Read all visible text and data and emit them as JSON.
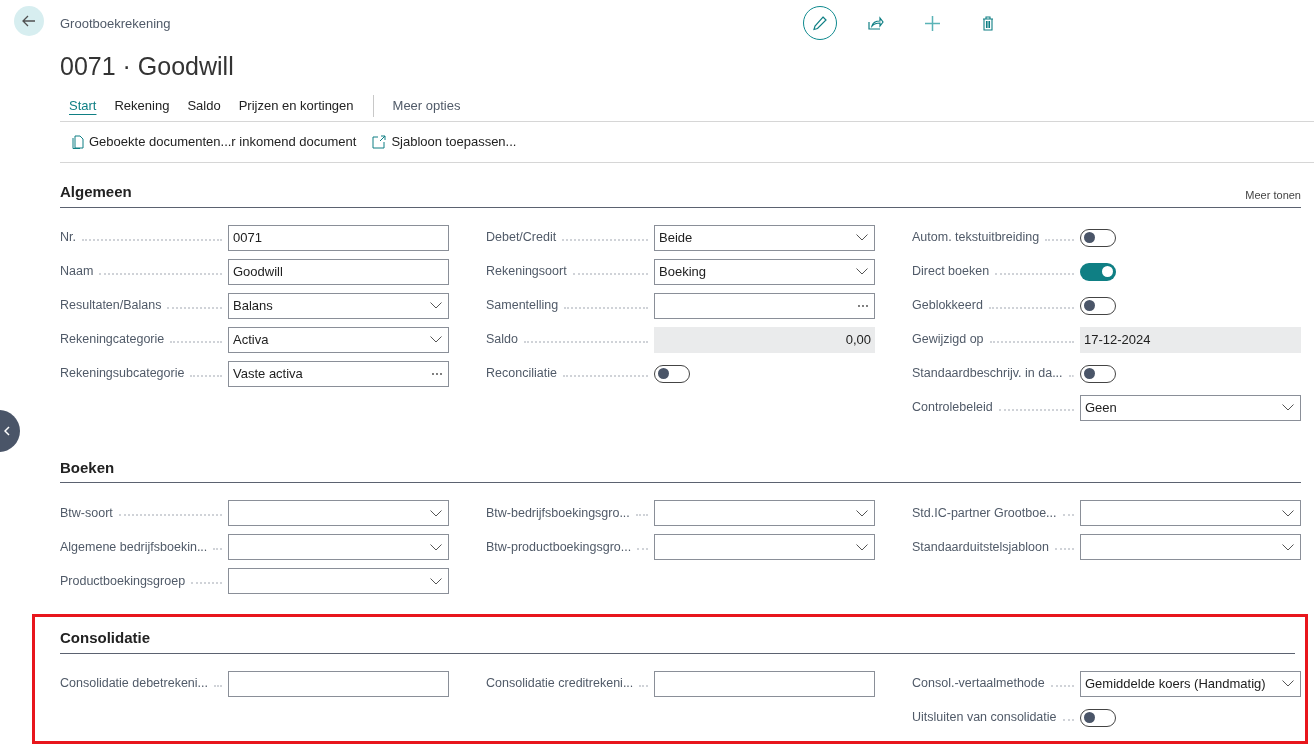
{
  "header": {
    "breadcrumb": "Grootboekrekening",
    "title": "0071 · Goodwill"
  },
  "tabs": [
    {
      "label": "Start",
      "selected": true
    },
    {
      "label": "Rekening",
      "selected": false
    },
    {
      "label": "Saldo",
      "selected": false
    },
    {
      "label": "Prijzen en kortingen",
      "selected": false
    }
  ],
  "more_options": "Meer opties",
  "actions": [
    {
      "label": "Geboekte documenten...r inkomend document",
      "kind": "document"
    },
    {
      "label": "Sjabloon toepassen...",
      "kind": "template"
    }
  ],
  "sections": [
    {
      "title": "Algemeen",
      "show_more": "Meer tonen",
      "highlighted": false,
      "columns": [
        [
          {
            "label": "Nr.",
            "kind": "text",
            "value": "0071"
          },
          {
            "label": "Naam",
            "kind": "text",
            "value": "Goodwill"
          },
          {
            "label": "Resultaten/Balans",
            "kind": "select",
            "value": "Balans"
          },
          {
            "label": "Rekeningcategorie",
            "kind": "select",
            "value": "Activa"
          },
          {
            "label": "Rekeningsubcategorie",
            "kind": "lookup",
            "value": "Vaste activa"
          }
        ],
        [
          {
            "label": "Debet/Credit",
            "kind": "select",
            "value": "Beide"
          },
          {
            "label": "Rekeningsoort",
            "kind": "select",
            "value": "Boeking"
          },
          {
            "label": "Samentelling",
            "kind": "lookup"
          },
          {
            "label": "Saldo",
            "kind": "amount",
            "value": "0,00"
          },
          {
            "label": "Reconciliatie",
            "kind": "toggle",
            "on": false
          }
        ],
        [
          {
            "label": "Autom. tekstuitbreiding",
            "kind": "toggle",
            "on": false
          },
          {
            "label": "Direct boeken",
            "kind": "toggle",
            "on": true
          },
          {
            "label": "Geblokkeerd",
            "kind": "toggle",
            "on": false
          },
          {
            "label": "Gewijzigd op",
            "kind": "readonly",
            "value": "17-12-2024"
          },
          {
            "label": "Standaardbeschrijv. in da...",
            "kind": "toggle",
            "on": false
          },
          {
            "label": "Controlebeleid",
            "kind": "select",
            "value": "Geen"
          }
        ]
      ]
    },
    {
      "title": "Boeken",
      "highlighted": false,
      "columns": [
        [
          {
            "label": "Btw-soort",
            "kind": "select"
          },
          {
            "label": "Algemene bedrijfsboekin...",
            "kind": "select"
          },
          {
            "label": "Productboekingsgroep",
            "kind": "select"
          }
        ],
        [
          {
            "label": "Btw-bedrijfsboekingsgro...",
            "kind": "select"
          },
          {
            "label": "Btw-productboekingsgro...",
            "kind": "select"
          }
        ],
        [
          {
            "label": "Std.IC-partner Grootboe...",
            "kind": "select"
          },
          {
            "label": "Standaarduitstelsjabloon",
            "kind": "select"
          }
        ]
      ]
    },
    {
      "title": "Consolidatie",
      "highlighted": true,
      "columns": [
        [
          {
            "label": "Consolidatie debetrekeni...",
            "kind": "text"
          }
        ],
        [
          {
            "label": "Consolidatie creditrekeni...",
            "kind": "text"
          }
        ],
        [
          {
            "label": "Consol.-vertaalmethode",
            "kind": "select",
            "value": "Gemiddelde koers (Handmatig)"
          },
          {
            "label": "Uitsluiten van consolidatie",
            "kind": "toggle",
            "on": false
          }
        ]
      ]
    }
  ]
}
